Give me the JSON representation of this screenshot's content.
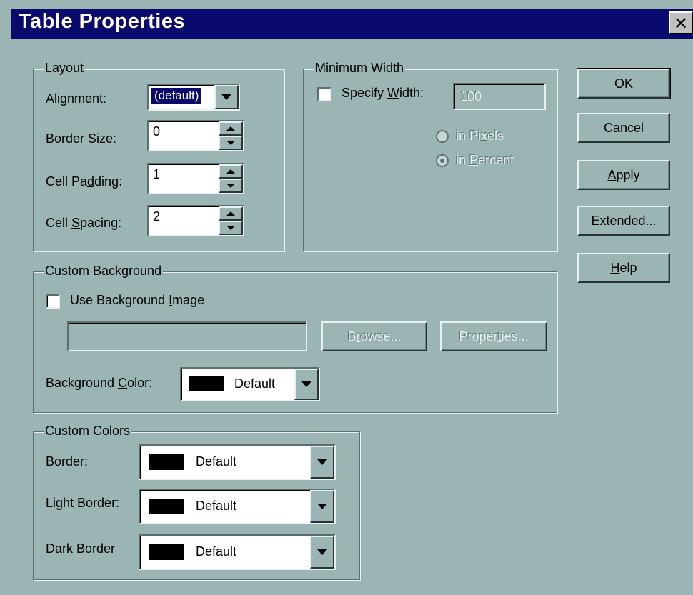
{
  "window": {
    "title": "Table Properties",
    "close_glyph": "✕"
  },
  "layout": {
    "legend": "Layout",
    "alignment_label": "Alignment:",
    "alignment_value": "(default)",
    "border_size_label": "Border Size:",
    "border_size_value": "0",
    "cell_padding_label": "Cell Padding:",
    "cell_padding_value": "1",
    "cell_spacing_label": "Cell Spacing:",
    "cell_spacing_value": "2"
  },
  "min_width": {
    "legend": "Minimum Width",
    "specify_label": "Specify Width:",
    "width_value": "100",
    "pixels_label": "in Pixels",
    "percent_label": "in Percent",
    "selected": "percent"
  },
  "buttons": {
    "ok": "OK",
    "cancel": "Cancel",
    "apply": "Apply",
    "extended": "Extended...",
    "help": "Help"
  },
  "custom_background": {
    "legend": "Custom Background",
    "use_image_label": "Use Background Image",
    "image_path": "",
    "browse": "Browse...",
    "properties": "Properties...",
    "color_label": "Background Color:",
    "color_value": "Default",
    "color_swatch": "#000000"
  },
  "custom_colors": {
    "legend": "Custom Colors",
    "border_label": "Border:",
    "border_value": "Default",
    "light_border_label": "Light Border:",
    "light_border_value": "Default",
    "dark_border_label": "Dark Border",
    "dark_border_value": "Default",
    "swatch": "#000000"
  },
  "theme": {
    "dialog_bg": "#9bb4b4",
    "titlebar_bg": "#0a0a6e",
    "selection_bg": "#0a0a6e"
  }
}
